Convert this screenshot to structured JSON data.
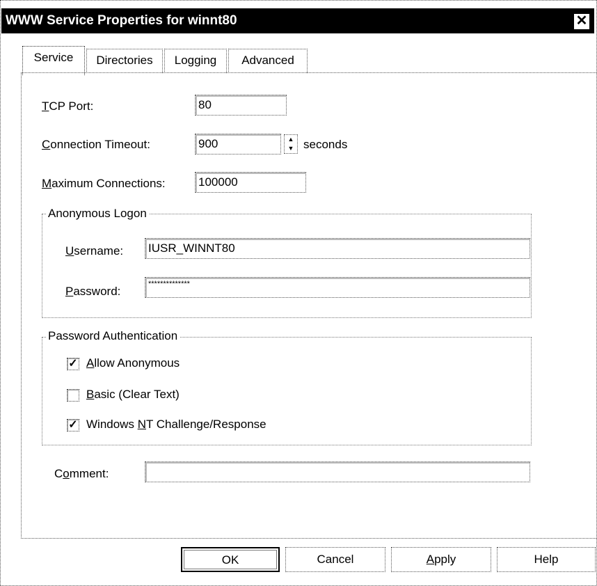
{
  "window": {
    "title": "WWW Service Properties for winnt80",
    "close_symbol": "✕"
  },
  "tabs": [
    {
      "label": "Service"
    },
    {
      "label": "Directories"
    },
    {
      "label": "Logging"
    },
    {
      "label": "Advanced"
    }
  ],
  "service": {
    "tcp_port": {
      "label_pre": "",
      "label_key": "T",
      "label_post": "CP Port:",
      "value": "80"
    },
    "connection_timeout": {
      "label_key": "C",
      "label_post": "onnection Timeout:",
      "value": "900",
      "unit": "seconds"
    },
    "max_connections": {
      "label_key": "M",
      "label_post": "aximum Connections:",
      "value": "100000"
    }
  },
  "anonymous_logon": {
    "title": "Anonymous Logon",
    "username": {
      "label_key": "U",
      "label_post": "sername:",
      "value": "IUSR_WINNT80"
    },
    "password": {
      "label_key": "P",
      "label_post": "assword:",
      "value": "**************"
    }
  },
  "password_auth": {
    "title": "Password Authentication",
    "allow_anonymous": {
      "label_key": "A",
      "label_post": "llow Anonymous",
      "checked": true,
      "mark": "✓"
    },
    "basic": {
      "label_key": "B",
      "label_post": "asic (Clear Text)",
      "checked": false,
      "mark": ""
    },
    "nt_challenge": {
      "label_pre": "Windows ",
      "label_key": "N",
      "label_post": "T Challenge/Response",
      "checked": true,
      "mark": "✓"
    }
  },
  "comment": {
    "label_pre": "C",
    "label_key": "o",
    "label_post": "mment:",
    "value": ""
  },
  "buttons": {
    "ok": "OK",
    "cancel": "Cancel",
    "apply_key": "A",
    "apply_post": "pply",
    "help": "Help"
  }
}
